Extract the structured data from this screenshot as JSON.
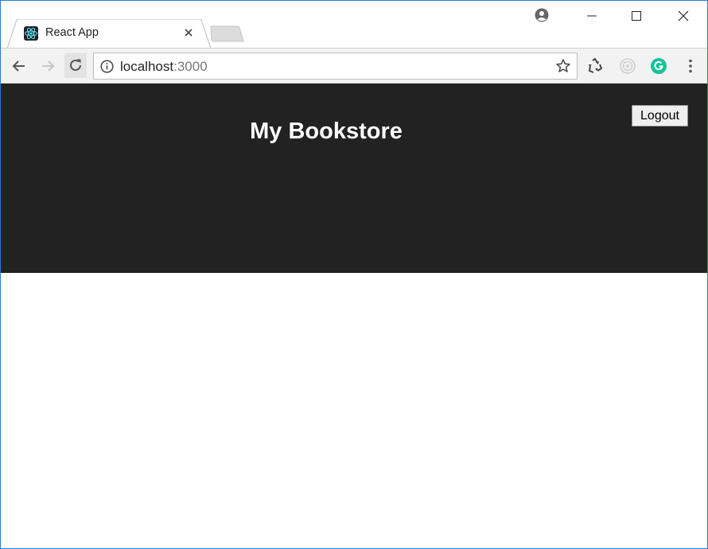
{
  "browser": {
    "tab": {
      "title": "React App",
      "favicon": "react-logo-icon"
    },
    "address_bar": {
      "host": "localhost",
      "port": ":3000"
    },
    "icons": {
      "back": "arrow-left-icon",
      "forward": "arrow-right-icon",
      "reload": "reload-icon",
      "info": "info-icon",
      "bookmark": "star-icon",
      "recycle_extension": "recycle-icon",
      "target_extension": "target-icon",
      "grammarly_extension": "grammarly-icon",
      "menu": "kebab-menu-icon",
      "account": "account-icon",
      "minimize": "minimize-icon",
      "maximize": "maximize-icon",
      "close": "close-icon"
    },
    "colors": {
      "window_border": "#2a7ad6",
      "react_cyan": "#61dafb",
      "grammarly_green": "#15c39a"
    }
  },
  "app": {
    "title": "My Bookstore",
    "logout_label": "Logout",
    "colors": {
      "header_bg": "#222222",
      "title_color": "#ffffff"
    }
  }
}
